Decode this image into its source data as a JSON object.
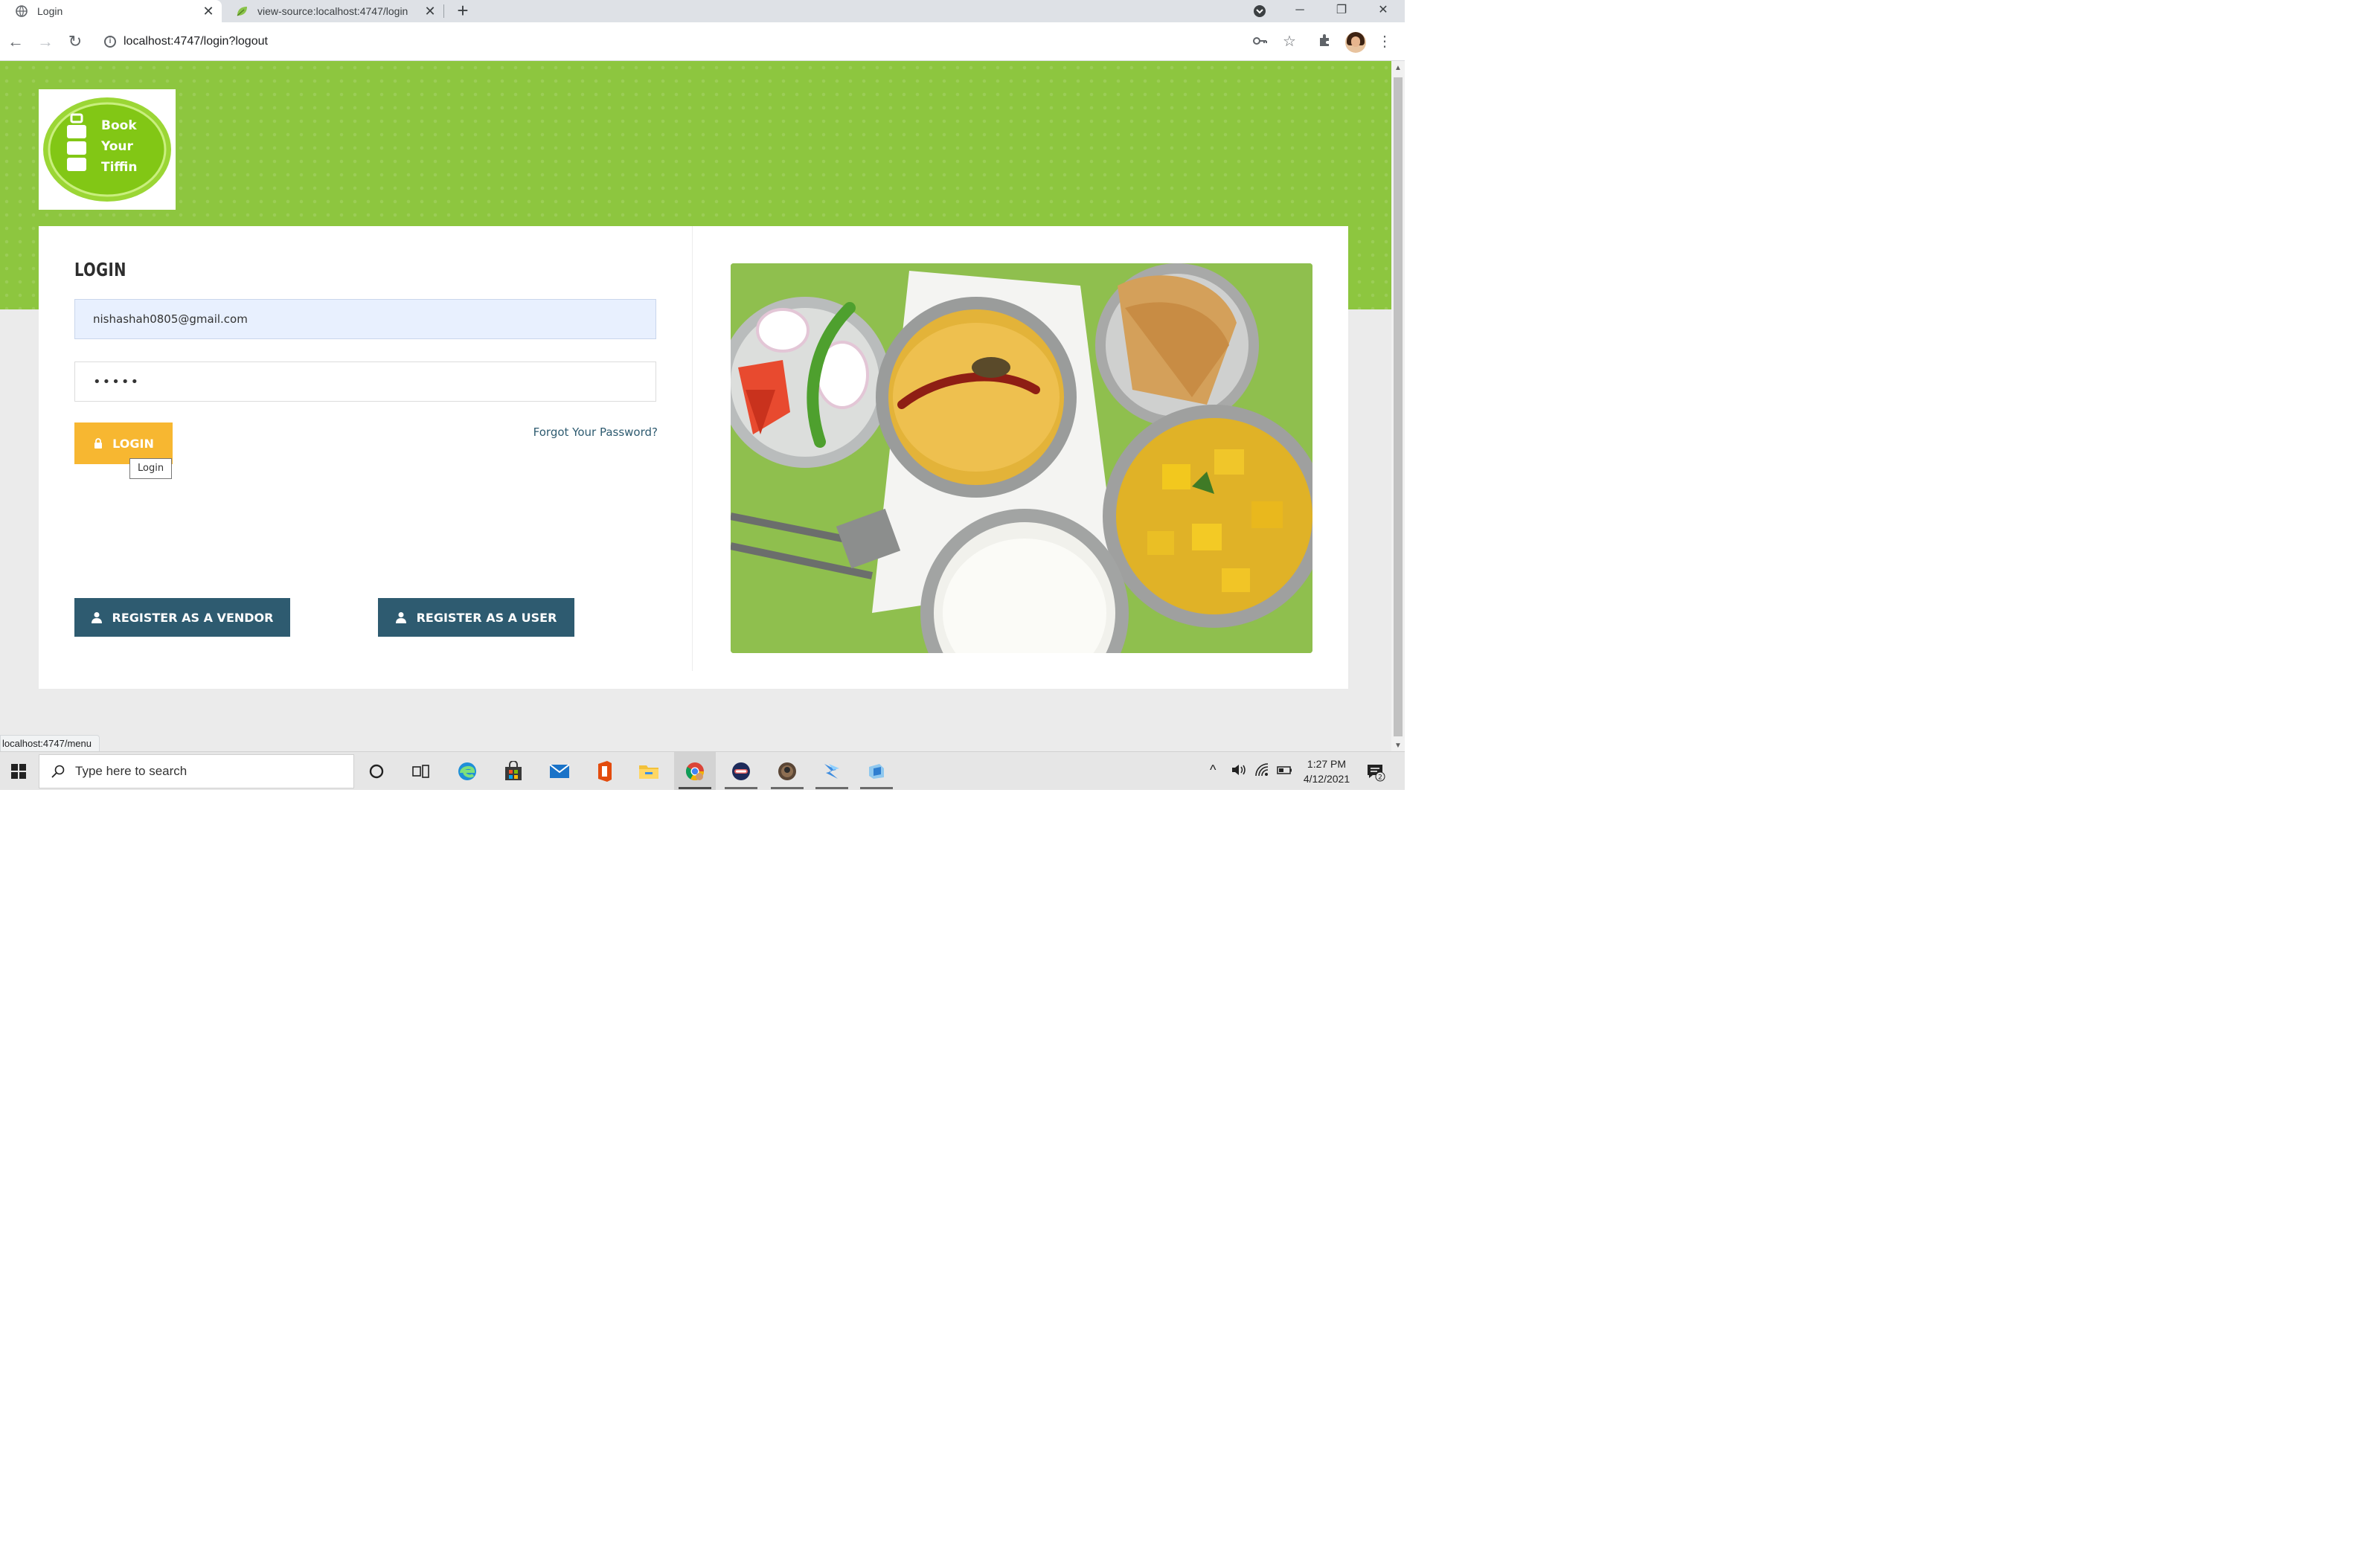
{
  "browser": {
    "tabs": [
      {
        "title": "Login",
        "active": true
      },
      {
        "title": "view-source:localhost:4747/login",
        "active": false
      }
    ],
    "url": "localhost:4747/login?logout",
    "status_url": "localhost:4747/menu"
  },
  "page": {
    "logo_text": [
      "Book",
      "Your",
      "Tiffin"
    ],
    "login": {
      "heading": "LOGIN",
      "email_value": "nishashah0805@gmail.com",
      "password_value": "•••••",
      "login_button": "LOGIN",
      "tooltip": "Login",
      "forgot_link": "Forgot Your Password?"
    },
    "register_vendor_button": "REGISTER AS A VENDOR",
    "register_user_button": "REGISTER AS A USER"
  },
  "taskbar": {
    "search_placeholder": "Type here to search",
    "time": "1:27 PM",
    "date": "4/12/2021",
    "notification_count": "2"
  },
  "colors": {
    "brand_green": "#8dc63f",
    "login_button": "#f7b731",
    "register_button": "#2e5b70"
  }
}
